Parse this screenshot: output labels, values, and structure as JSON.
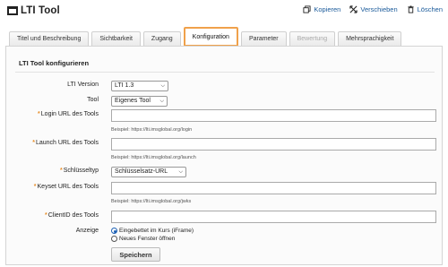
{
  "header": {
    "title": "LTI Tool",
    "actions": [
      {
        "label": "Kopieren",
        "icon": "copy-icon"
      },
      {
        "label": "Verschieben",
        "icon": "move-icon"
      },
      {
        "label": "Löschen",
        "icon": "trash-icon"
      }
    ]
  },
  "tabs": [
    {
      "label": "Titel und Beschreibung",
      "state": "normal"
    },
    {
      "label": "Sichtbarkeit",
      "state": "normal"
    },
    {
      "label": "Zugang",
      "state": "normal"
    },
    {
      "label": "Konfiguration",
      "state": "active"
    },
    {
      "label": "Parameter",
      "state": "normal"
    },
    {
      "label": "Bewertung",
      "state": "disabled"
    },
    {
      "label": "Mehrsprachigkeit",
      "state": "normal"
    }
  ],
  "form": {
    "section_title": "LTI Tool konfigurieren",
    "lti_version": {
      "label": "LTI Version",
      "value": "LTI 1.3"
    },
    "tool": {
      "label": "Tool",
      "value": "Eigenes Tool"
    },
    "login_url": {
      "label": "Login URL des Tools",
      "value": "",
      "hint": "Beispiel: https://lti.imsglobal.org/login"
    },
    "launch_url": {
      "label": "Launch URL des Tools",
      "value": "",
      "hint": "Beispiel: https://lti.imsglobal.org/launch"
    },
    "key_type": {
      "label": "Schlüsseltyp",
      "value": "Schlüsselsatz-URL"
    },
    "keyset_url": {
      "label": "Keyset URL des Tools",
      "value": "",
      "hint": "Beispiel: https://lti.imsglobal.org/jwks"
    },
    "client_id": {
      "label": "ClientID des Tools",
      "value": ""
    },
    "display": {
      "label": "Anzeige",
      "options": [
        {
          "label": "Eingebettet im Kurs (iFrame)",
          "checked": true
        },
        {
          "label": "Neues Fenster öffnen",
          "checked": false
        }
      ]
    },
    "save_label": "Speichern"
  },
  "colors": {
    "accent": "#f0a14b",
    "link": "#1a5a9a",
    "required": "#e8902d"
  }
}
